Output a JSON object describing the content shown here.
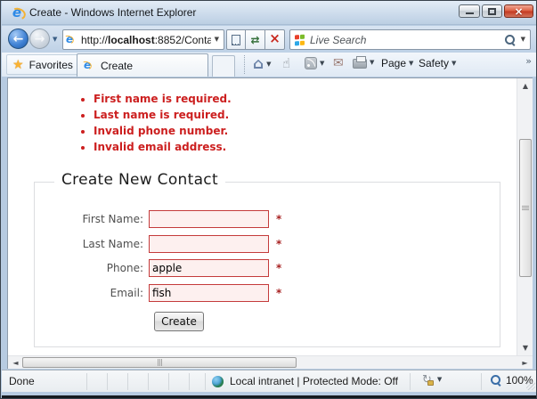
{
  "window": {
    "title": "Create - Windows Internet Explorer"
  },
  "navbar": {
    "url_prefix": "http://",
    "url_host": "localhost",
    "url_suffix": ":8852/Conta",
    "search_placeholder": "Live Search"
  },
  "favbar": {
    "favorites_label": "Favorites",
    "active_tab_label": "Create",
    "page_menu_label": "Page",
    "safety_menu_label": "Safety"
  },
  "page": {
    "errors": [
      "First name is required.",
      "Last name is required.",
      "Invalid phone number.",
      "Invalid email address."
    ],
    "form": {
      "legend": "Create New Contact",
      "fields": [
        {
          "label": "First Name:",
          "value": "",
          "required_marker": "*"
        },
        {
          "label": "Last Name:",
          "value": "",
          "required_marker": "*"
        },
        {
          "label": "Phone:",
          "value": "apple",
          "required_marker": "*"
        },
        {
          "label": "Email:",
          "value": "fish",
          "required_marker": "*"
        }
      ],
      "submit_label": "Create"
    }
  },
  "statusbar": {
    "status_text": "Done",
    "zone_text": "Local intranet | Protected Mode: Off",
    "zoom_level": "100%"
  },
  "icons": {
    "ie_logo": "e",
    "back": "←",
    "forward": "→",
    "caret": "▼",
    "refresh": "⇄",
    "stop": "×",
    "favorites_star": "★",
    "home": "⌂",
    "hand": "☝",
    "mail": "✉",
    "overflow_chevron": "»",
    "inprivate_refresh": "↻",
    "scroll_up": "▲",
    "scroll_down": "▼",
    "scroll_left": "◄",
    "scroll_right": "►"
  },
  "colors": {
    "error_text": "#cc1f1f",
    "input_border": "#c43b3b",
    "input_background": "#fdf0ef",
    "frame_blue": "#b7cbe1",
    "close_button_red": "#c43a22"
  }
}
